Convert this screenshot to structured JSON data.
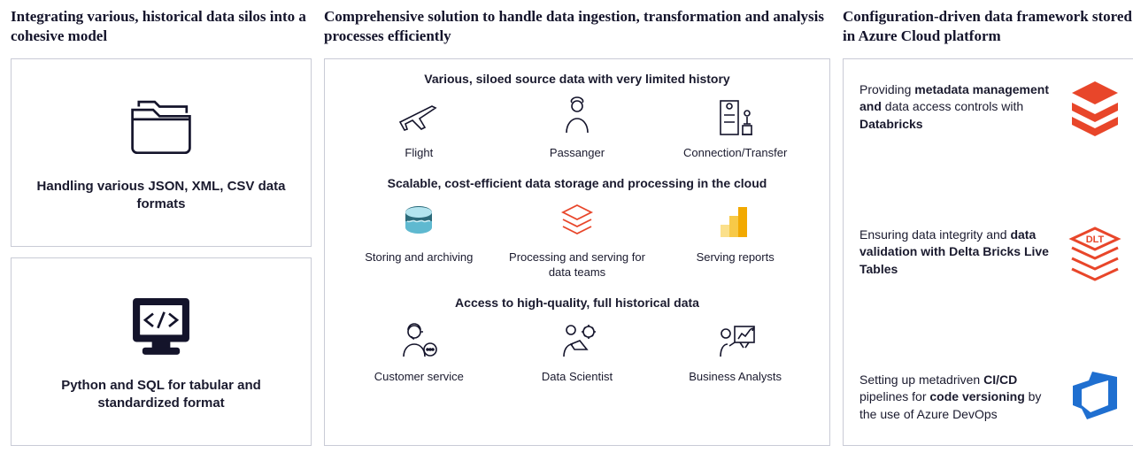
{
  "left": {
    "title": "Integrating various, historical data silos into a cohesive model",
    "cards": [
      {
        "label": "Handling various JSON, XML, CSV data formats"
      },
      {
        "label": "Python and SQL for tabular and standardized format"
      }
    ]
  },
  "mid": {
    "title": "Comprehensive solution to handle data ingestion, transformation and analysis processes efficiently",
    "sections": [
      {
        "heading": "Various, siloed source data with very limited history",
        "items": [
          "Flight",
          "Passanger",
          "Connection/Transfer"
        ]
      },
      {
        "heading": "Scalable, cost-efficient data storage and processing in the cloud",
        "items": [
          "Storing and archiving",
          "Processing and  serving for data teams",
          "Serving reports"
        ]
      },
      {
        "heading": "Access to high-quality, full historical data",
        "items": [
          "Customer service",
          "Data Scientist",
          "Business Analysts"
        ]
      }
    ]
  },
  "right": {
    "title": "Configuration-driven data framework stored in Azure Cloud platform",
    "rows": [
      {
        "html": "Providing <b>metadata management and</b> data access controls with <b>Databricks</b>"
      },
      {
        "html": "Ensuring data integrity and <b>data validation with Delta Bricks Live Tables</b>"
      },
      {
        "html": "Setting up metadriven <b>CI/CD</b> pipelines for <b>code versioning</b> by the use of Azure DevOps"
      }
    ]
  }
}
